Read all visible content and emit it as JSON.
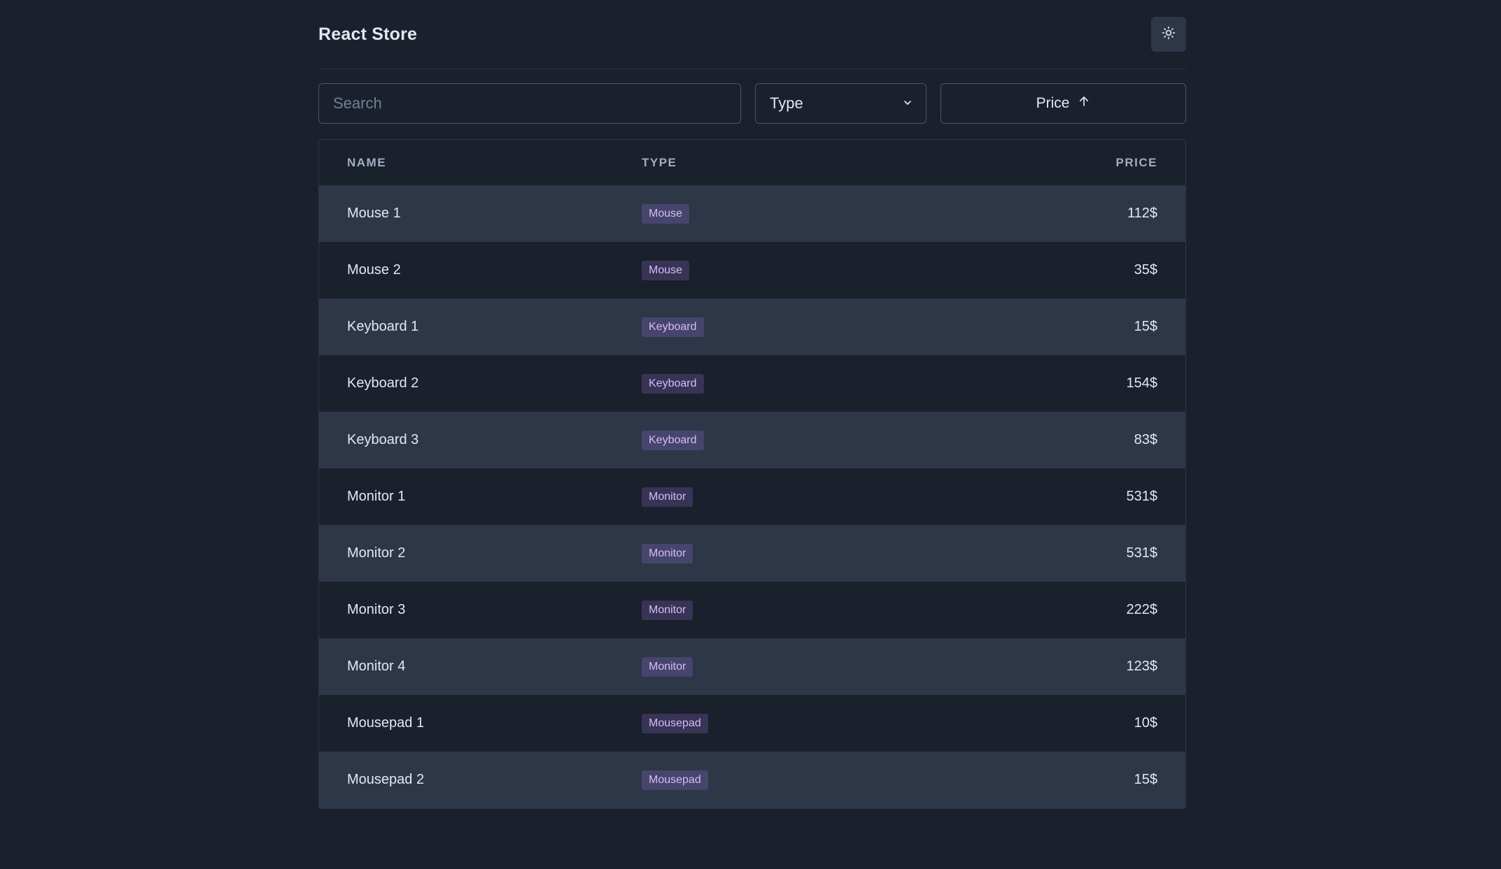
{
  "app": {
    "title": "React Store"
  },
  "header": {
    "theme_toggle_icon": "sun-icon"
  },
  "controls": {
    "search_placeholder": "Search",
    "type_select_value": "Type",
    "sort_label": "Price",
    "sort_direction_icon": "arrow-up-icon"
  },
  "table": {
    "columns": {
      "name": "NAME",
      "type": "TYPE",
      "price": "PRICE"
    },
    "rows": [
      {
        "name": "Mouse 1",
        "type": "Mouse",
        "price": "112$"
      },
      {
        "name": "Mouse 2",
        "type": "Mouse",
        "price": "35$"
      },
      {
        "name": "Keyboard 1",
        "type": "Keyboard",
        "price": "15$"
      },
      {
        "name": "Keyboard 2",
        "type": "Keyboard",
        "price": "154$"
      },
      {
        "name": "Keyboard 3",
        "type": "Keyboard",
        "price": "83$"
      },
      {
        "name": "Monitor 1",
        "type": "Monitor",
        "price": "531$"
      },
      {
        "name": "Monitor 2",
        "type": "Monitor",
        "price": "531$"
      },
      {
        "name": "Monitor 3",
        "type": "Monitor",
        "price": "222$"
      },
      {
        "name": "Monitor 4",
        "type": "Monitor",
        "price": "123$"
      },
      {
        "name": "Mousepad 1",
        "type": "Mousepad",
        "price": "10$"
      },
      {
        "name": "Mousepad 2",
        "type": "Mousepad",
        "price": "15$"
      }
    ]
  },
  "colors": {
    "background": "#1a202c",
    "row_alt": "#2d3748",
    "badge_text": "#d6bcfa",
    "text": "#e2e8f0",
    "header_text": "#a0aec0"
  }
}
